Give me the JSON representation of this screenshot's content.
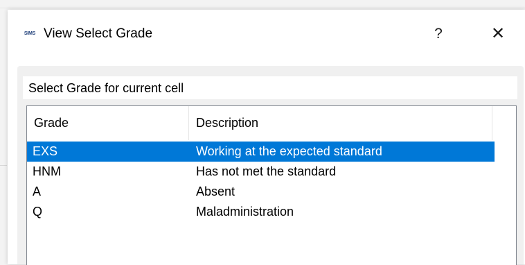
{
  "window": {
    "icon_text": "SIMS",
    "title": "View Select Grade",
    "help_label": "?",
    "close_label": "✕"
  },
  "prompt": "Select Grade for current cell",
  "list": {
    "columns": [
      "Grade",
      "Description"
    ],
    "rows": [
      {
        "grade": "EXS",
        "description": "Working at the expected standard",
        "selected": true
      },
      {
        "grade": "HNM",
        "description": "Has not met the standard",
        "selected": false
      },
      {
        "grade": "A",
        "description": "Absent",
        "selected": false
      },
      {
        "grade": "Q",
        "description": "Maladministration",
        "selected": false
      }
    ]
  },
  "colors": {
    "selection": "#0078d7",
    "client_background": "#f0f0f0"
  }
}
